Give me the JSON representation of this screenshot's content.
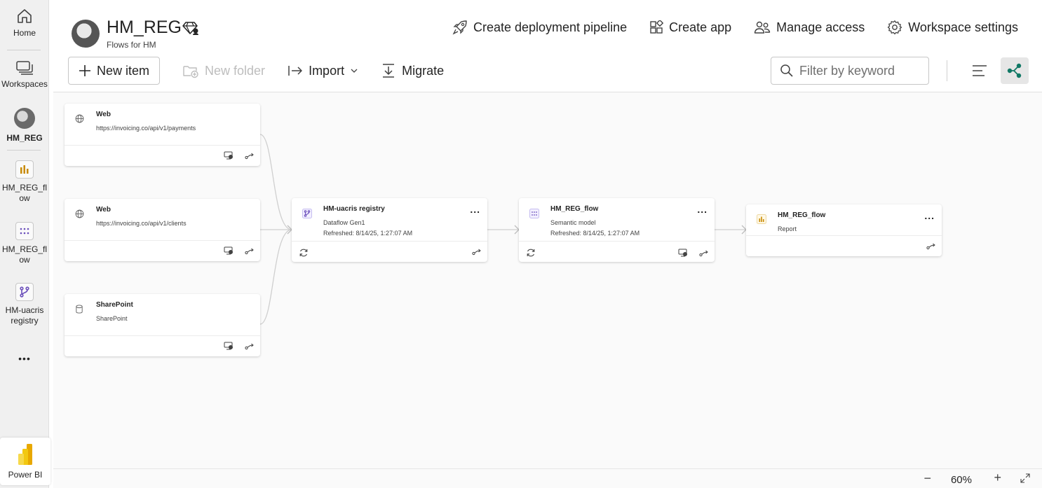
{
  "rail": {
    "home": "Home",
    "workspaces": "Workspaces",
    "current_ws": "HM_REG",
    "item1": "HM_REG_flow",
    "item2": "HM_REG_flow",
    "item3": "HM-uacris registry",
    "more": "•••",
    "product": "Power BI"
  },
  "workspace": {
    "title": "HM_REG",
    "subtitle": "Flows for HM"
  },
  "top_actions": {
    "pipeline": "Create deployment pipeline",
    "app": "Create app",
    "access": "Manage access",
    "settings": "Workspace settings"
  },
  "toolbar": {
    "new_item": "New item",
    "new_folder": "New folder",
    "import": "Import",
    "migrate": "Migrate"
  },
  "filter": {
    "placeholder": "Filter by keyword"
  },
  "lineage": {
    "sources": [
      {
        "title": "Web",
        "subtitle": "https://invoicing.co/api/v1/payments",
        "icon": "globe-icon"
      },
      {
        "title": "Web",
        "subtitle": "https://invoicing.co/api/v1/clients",
        "icon": "globe-icon"
      },
      {
        "title": "SharePoint",
        "subtitle": "SharePoint",
        "icon": "database-icon"
      }
    ],
    "dataflow": {
      "title": "HM-uacris registry",
      "type": "Dataflow Gen1",
      "refreshed": "Refreshed: 8/14/25, 1:27:07 AM"
    },
    "model": {
      "title": "HM_REG_flow",
      "type": "Semantic model",
      "refreshed": "Refreshed: 8/14/25, 1:27:07 AM"
    },
    "report": {
      "title": "HM_REG_flow",
      "type": "Report"
    },
    "more": "..."
  },
  "zoom": {
    "minus": "−",
    "value": "60%",
    "plus": "+"
  },
  "colors": {
    "accent": "#117865",
    "report_icon": "#c88a00",
    "dataflow_icon": "#6b4fbb"
  }
}
